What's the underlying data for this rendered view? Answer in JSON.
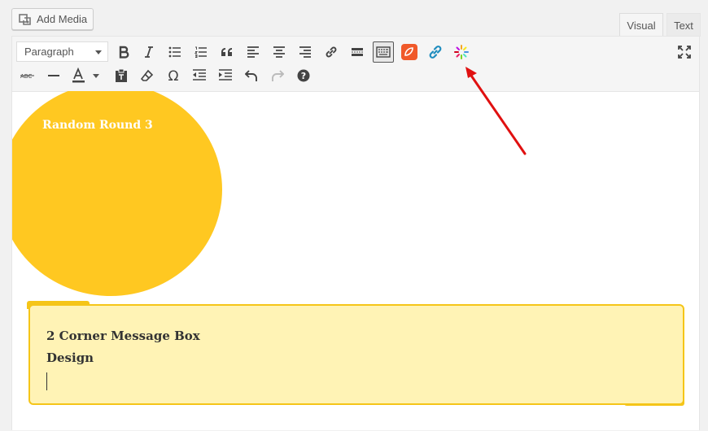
{
  "add_media": {
    "label": "Add Media"
  },
  "tabs": {
    "visual": "Visual",
    "text": "Text"
  },
  "toolbar": {
    "format_select": "Paragraph"
  },
  "content": {
    "shape_title": "Random Round 3",
    "message_box": {
      "line1": "2 Corner Message Box",
      "line2": "Design"
    }
  },
  "colors": {
    "circle": "#ffc821",
    "message_bg": "#fff3b5",
    "message_border": "#f5c518",
    "arrow": "#e01010"
  }
}
